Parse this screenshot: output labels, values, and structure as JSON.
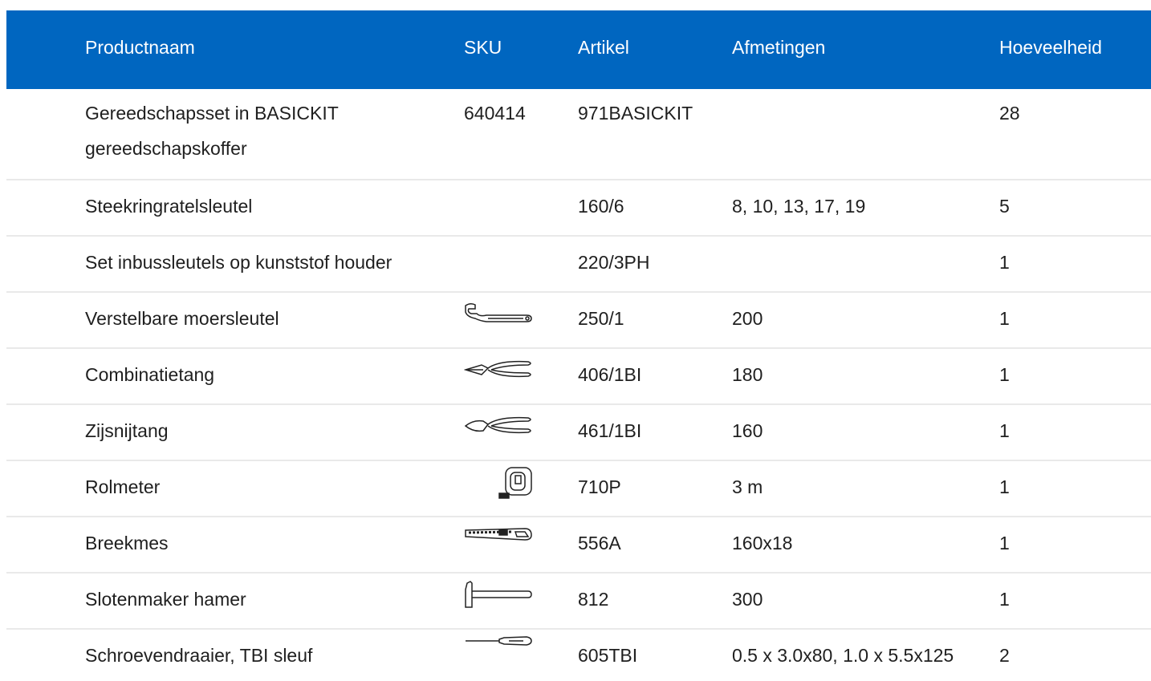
{
  "headers": {
    "name": "Productnaam",
    "sku": "SKU",
    "article": "Artikel",
    "dimensions": "Afmetingen",
    "quantity": "Hoeveelheid"
  },
  "rows": [
    {
      "name_line1": "Gereedschapsset in BASICKIT",
      "name_line2": "gereedschapskoffer",
      "sku": "640414",
      "article": "971BASICKIT",
      "dimensions": "",
      "quantity": "28",
      "icon": ""
    },
    {
      "name_line1": "Steekringratelsleutel",
      "name_line2": "",
      "sku": "",
      "article": "160/6",
      "dimensions": "8, 10, 13, 17, 19",
      "quantity": "5",
      "icon": ""
    },
    {
      "name_line1": "Set inbussleutels op kunststof houder",
      "name_line2": "",
      "sku": "",
      "article": "220/3PH",
      "dimensions": "",
      "quantity": "1",
      "icon": ""
    },
    {
      "name_line1": "Verstelbare moersleutel",
      "name_line2": "",
      "sku": "",
      "article": "250/1",
      "dimensions": "200",
      "quantity": "1",
      "icon": "adjustable-wrench-icon"
    },
    {
      "name_line1": "Combinatietang",
      "name_line2": "",
      "sku": "",
      "article": "406/1BI",
      "dimensions": "180",
      "quantity": "1",
      "icon": "combination-pliers-icon"
    },
    {
      "name_line1": "Zijsnijtang",
      "name_line2": "",
      "sku": "",
      "article": "461/1BI",
      "dimensions": "160",
      "quantity": "1",
      "icon": "side-cutter-icon"
    },
    {
      "name_line1": "Rolmeter",
      "name_line2": "",
      "sku": "",
      "article": "710P",
      "dimensions": "3 m",
      "quantity": "1",
      "icon": "tape-measure-icon"
    },
    {
      "name_line1": "Breekmes",
      "name_line2": "",
      "sku": "",
      "article": "556A",
      "dimensions": "160x18",
      "quantity": "1",
      "icon": "utility-knife-icon"
    },
    {
      "name_line1": "Slotenmaker hamer",
      "name_line2": "",
      "sku": "",
      "article": "812",
      "dimensions": "300",
      "quantity": "1",
      "icon": "hammer-icon"
    },
    {
      "name_line1": "Schroevendraaier, TBI sleuf",
      "name_line2": "",
      "sku": "",
      "article": "605TBI",
      "dimensions": "0.5 x 3.0x80, 1.0 x 5.5x125",
      "quantity": "2",
      "icon": "screwdriver-icon"
    }
  ],
  "colors": {
    "header_bg": "#0066c0",
    "header_text": "#ffffff",
    "divider": "#e9e9e9"
  }
}
